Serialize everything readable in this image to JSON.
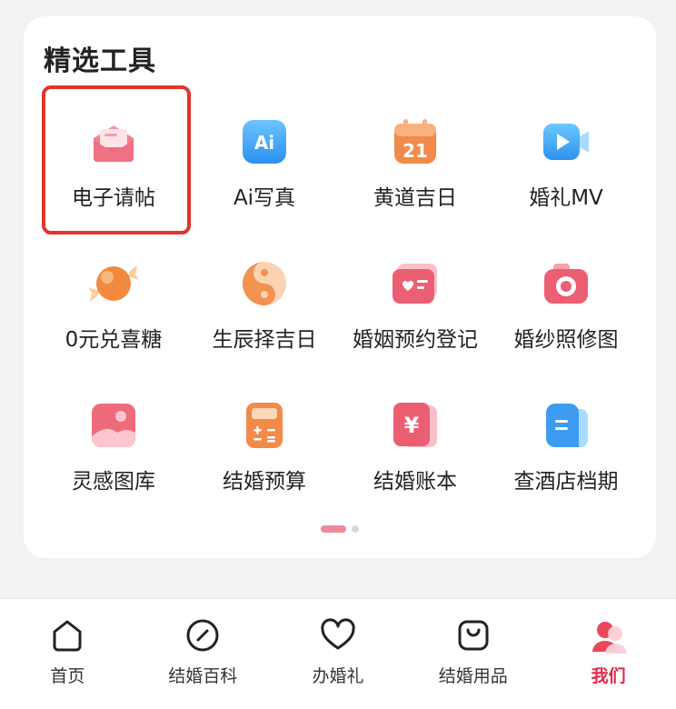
{
  "section": {
    "title": "精选工具"
  },
  "tools": [
    {
      "label": "电子请帖",
      "icon": "envelope-icon"
    },
    {
      "label": "Ai写真",
      "icon": "ai-icon"
    },
    {
      "label": "黄道吉日",
      "icon": "calendar-icon",
      "badge": "21"
    },
    {
      "label": "婚礼MV",
      "icon": "video-icon"
    },
    {
      "label": "0元兑喜糖",
      "icon": "candy-icon"
    },
    {
      "label": "生辰择吉日",
      "icon": "yin-yang-icon"
    },
    {
      "label": "婚姻预约登记",
      "icon": "id-card-icon"
    },
    {
      "label": "婚纱照修图",
      "icon": "camera-icon"
    },
    {
      "label": "灵感图库",
      "icon": "gallery-icon"
    },
    {
      "label": "结婚预算",
      "icon": "calculator-icon"
    },
    {
      "label": "结婚账本",
      "icon": "ledger-icon",
      "badge": "¥"
    },
    {
      "label": "查酒店档期",
      "icon": "document-icon"
    }
  ],
  "pagination": {
    "current": 1,
    "total": 2
  },
  "tabbar": {
    "items": [
      {
        "label": "首页",
        "icon": "home-icon"
      },
      {
        "label": "结婚百科",
        "icon": "compass-icon"
      },
      {
        "label": "办婚礼",
        "icon": "heart-icon"
      },
      {
        "label": "结婚用品",
        "icon": "shopping-bag-icon"
      },
      {
        "label": "我们",
        "icon": "couple-icon"
      }
    ],
    "active": "我们"
  },
  "colors": {
    "accent": "#e02a4a",
    "selection": "#e0362b",
    "card": "#ffffff",
    "background": "#f2f2f4"
  }
}
